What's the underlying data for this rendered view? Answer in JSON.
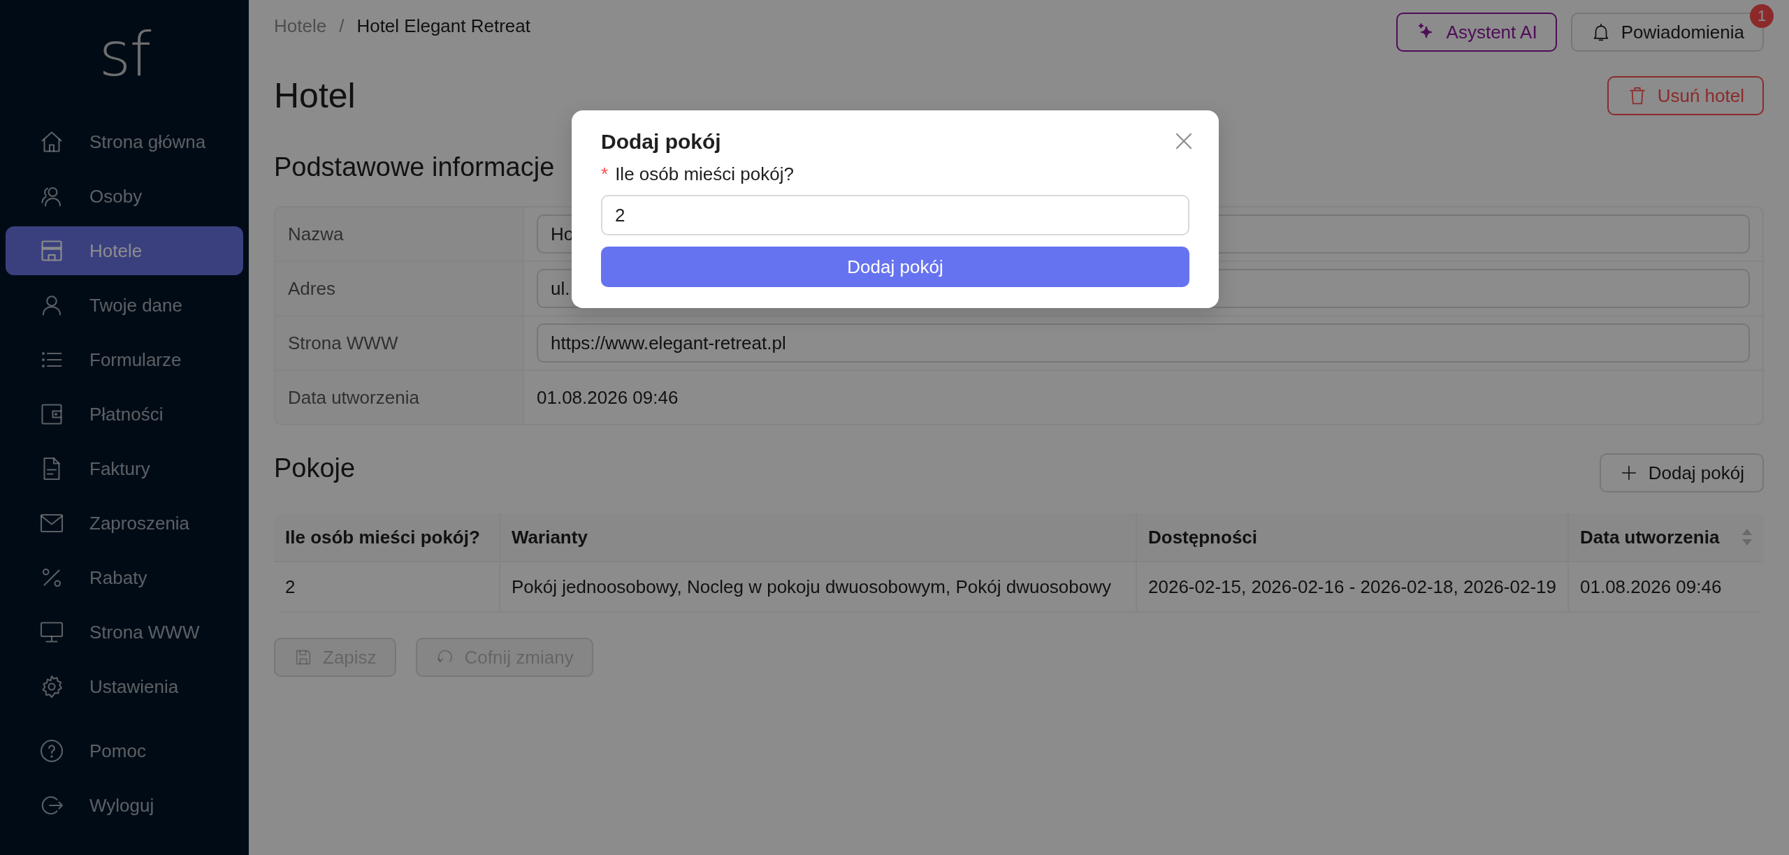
{
  "sidebar": {
    "logo": "sf",
    "items": [
      {
        "label": "Strona główna",
        "selected": false
      },
      {
        "label": "Osoby",
        "selected": false
      },
      {
        "label": "Hotele",
        "selected": true
      },
      {
        "label": "Twoje dane",
        "selected": false
      },
      {
        "label": "Formularze",
        "selected": false
      },
      {
        "label": "Płatności",
        "selected": false
      },
      {
        "label": "Faktury",
        "selected": false
      },
      {
        "label": "Zaproszenia",
        "selected": false
      },
      {
        "label": "Rabaty",
        "selected": false
      },
      {
        "label": "Strona WWW",
        "selected": false
      },
      {
        "label": "Ustawienia",
        "selected": false
      },
      {
        "label": "Pomoc",
        "selected": false
      },
      {
        "label": "Wyloguj",
        "selected": false
      }
    ]
  },
  "breadcrumb": {
    "parent": "Hotele",
    "separator": "/",
    "current": "Hotel Elegant Retreat"
  },
  "header_buttons": {
    "assistant": "Asystent AI",
    "notifications": {
      "label": "Powiadomienia",
      "badge": "1"
    }
  },
  "page_title": "Hotel",
  "delete_button": "Usuń hotel",
  "basic_info": {
    "title": "Podstawowe informacje",
    "fields": [
      {
        "label": "Nazwa",
        "kind": "input",
        "value": "Ho"
      },
      {
        "label": "Adres",
        "kind": "input",
        "value": "ul."
      },
      {
        "label": "Strona WWW",
        "kind": "input",
        "value": "https://www.elegant-retreat.pl"
      },
      {
        "label": "Data utworzenia",
        "kind": "text",
        "value": "01.08.2026 09:46"
      }
    ]
  },
  "rooms": {
    "title": "Pokoje",
    "add_button": "Dodaj pokój",
    "columns": [
      {
        "label": "Ile osób mieści pokój?",
        "sortable": false
      },
      {
        "label": "Warianty",
        "sortable": false
      },
      {
        "label": "Dostępności",
        "sortable": false
      },
      {
        "label": "Data utworzenia",
        "sortable": true
      }
    ],
    "rows": [
      [
        "2",
        "Pokój jednoosobowy, Nocleg w pokoju dwuosobowym, Pokój dwuosobowy",
        "2026-02-15, 2026-02-16 - 2026-02-18, 2026-02-19",
        "01.08.2026 09:46"
      ]
    ]
  },
  "actions": [
    {
      "label": "Zapisz",
      "disabled": true
    },
    {
      "label": "Cofnij zmiany",
      "disabled": true
    }
  ],
  "modal": {
    "title": "Dodaj pokój",
    "field": {
      "label": "Ile osób mieści pokój?",
      "required": true,
      "required_mark": "*",
      "value": "2"
    },
    "submit": "Dodaj pokój"
  }
}
